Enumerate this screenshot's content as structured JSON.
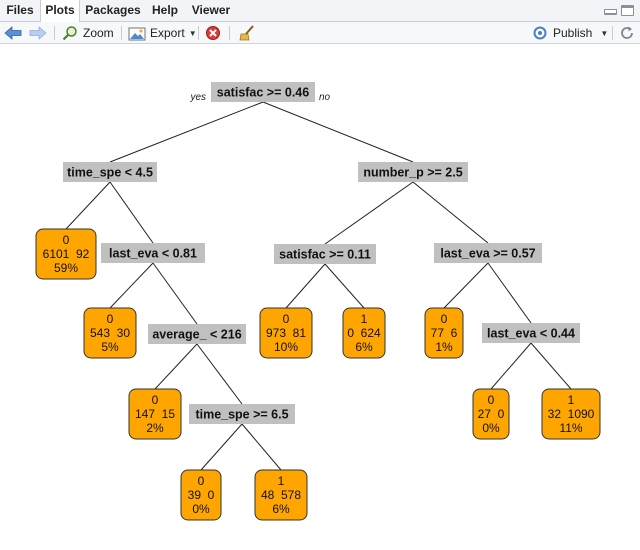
{
  "tabs": [
    "Files",
    "Plots",
    "Packages",
    "Help",
    "Viewer"
  ],
  "active_tab": "Plots",
  "toolbar": {
    "zoom_label": "Zoom",
    "export_label": "Export",
    "publish_label": "Publish"
  },
  "tree": {
    "edge_labels": {
      "yes": "yes",
      "no": "no"
    },
    "split_nodes": [
      {
        "id": "n1",
        "label": "satisfac >= 0.46"
      },
      {
        "id": "n2",
        "label": "time_spe < 4.5"
      },
      {
        "id": "n3",
        "label": "number_p >= 2.5"
      },
      {
        "id": "n5",
        "label": "last_eva < 0.81"
      },
      {
        "id": "n6",
        "label": "satisfac >= 0.11"
      },
      {
        "id": "n7",
        "label": "last_eva >= 0.57"
      },
      {
        "id": "n11",
        "label": "average_ < 216"
      },
      {
        "id": "n15",
        "label": "last_eva < 0.44"
      },
      {
        "id": "n23",
        "label": "time_spe >= 6.5"
      }
    ],
    "leaf_nodes": [
      {
        "id": "L4",
        "cls": "0",
        "counts": "6101  92",
        "pct": "59%"
      },
      {
        "id": "L10",
        "cls": "0",
        "counts": "543  30",
        "pct": "5%"
      },
      {
        "id": "L22",
        "cls": "0",
        "counts": "147  15",
        "pct": "2%"
      },
      {
        "id": "L46",
        "cls": "0",
        "counts": "39  0",
        "pct": "0%"
      },
      {
        "id": "L47",
        "cls": "1",
        "counts": "48  578",
        "pct": "6%"
      },
      {
        "id": "L12",
        "cls": "0",
        "counts": "973  81",
        "pct": "10%"
      },
      {
        "id": "L13",
        "cls": "1",
        "counts": "0  624",
        "pct": "6%"
      },
      {
        "id": "L14",
        "cls": "0",
        "counts": "77  6",
        "pct": "1%"
      },
      {
        "id": "L30",
        "cls": "0",
        "counts": "27  0",
        "pct": "0%"
      },
      {
        "id": "L31",
        "cls": "1",
        "counts": "32  1090",
        "pct": "11%"
      }
    ],
    "colors": {
      "leaf_fill": "#ffa500",
      "leaf_stroke": "#333333",
      "split_fill": "#c0c0c0",
      "edge": "#222222"
    }
  }
}
